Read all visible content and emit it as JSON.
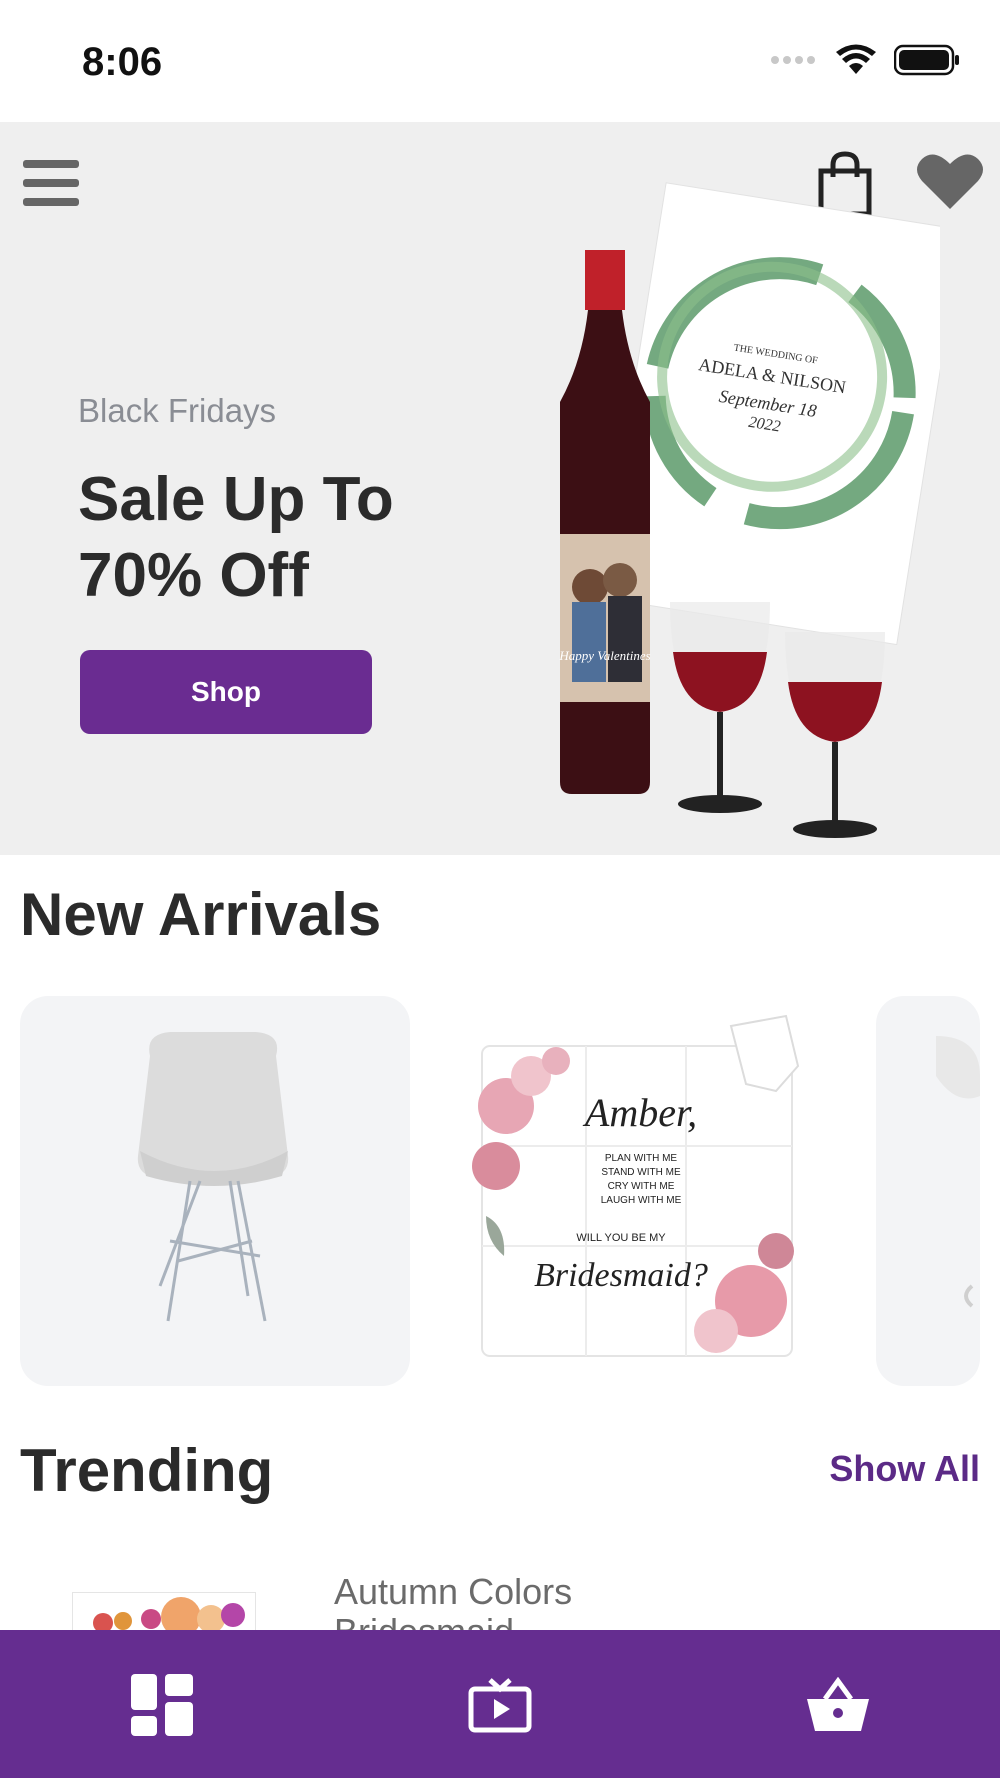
{
  "status_bar": {
    "time": "8:06"
  },
  "header": {
    "menu_icon": "hamburger-menu-icon",
    "bag_icon": "shopping-bag-icon",
    "favorite_icon": "heart-icon"
  },
  "hero": {
    "subtitle": "Black Fridays",
    "title": "Sale Up To 70% Off",
    "button_label": "Shop",
    "image": {
      "card_line1": "THE WEDDING OF",
      "card_line2": "ADELA & NILSON",
      "card_line3": "September 18",
      "card_line4": "2022",
      "bottle_label": "Happy Valentines"
    }
  },
  "new_arrivals": {
    "title": "New Arrivals",
    "items": [
      {
        "image": "white-chair"
      },
      {
        "image": "bridesmaid-puzzle",
        "text_name": "Amber,",
        "text_lines": [
          "PLAN WITH ME",
          "STAND WITH ME",
          "CRY WITH ME",
          "LAUGH WITH ME"
        ],
        "text_question": "WILL YOU BE MY",
        "text_role": "Bridesmaid?"
      },
      {
        "image": "partial-product"
      }
    ]
  },
  "trending": {
    "title": "Trending",
    "show_all": "Show All",
    "items": [
      {
        "name": "Autumn Colors Bridesmaid"
      }
    ]
  },
  "bottom_nav": {
    "items": [
      {
        "icon": "dashboard-icon"
      },
      {
        "icon": "video-play-icon"
      },
      {
        "icon": "basket-icon"
      }
    ]
  },
  "colors": {
    "brand_purple": "#652d90",
    "button_purple": "#6a2c91",
    "hero_bg": "#efefef"
  }
}
